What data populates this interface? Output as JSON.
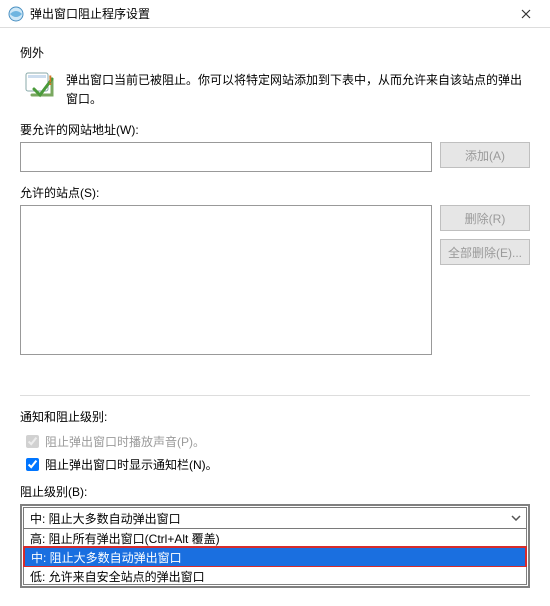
{
  "titlebar": {
    "title": "弹出窗口阻止程序设置"
  },
  "exceptions": {
    "heading": "例外",
    "description": "弹出窗口当前已被阻止。你可以将特定网站添加到下表中，从而允许来自该站点的弹出窗口。",
    "address_label": "要允许的网站地址(W):",
    "address_value": "",
    "add_button": "添加(A)",
    "sites_label": "允许的站点(S):",
    "remove_button": "删除(R)",
    "remove_all_button": "全部删除(E)..."
  },
  "notifications": {
    "heading": "通知和阻止级别:",
    "play_sound_label": "阻止弹出窗口时播放声音(P)。",
    "show_bar_label": "阻止弹出窗口时显示通知栏(N)。",
    "block_level_label": "阻止级别(B):",
    "selected_option": "中: 阻止大多数自动弹出窗口",
    "options": {
      "high": "高: 阻止所有弹出窗口(Ctrl+Alt 覆盖)",
      "mid": "中: 阻止大多数自动弹出窗口",
      "low": "低: 允许来自安全站点的弹出窗口"
    }
  }
}
